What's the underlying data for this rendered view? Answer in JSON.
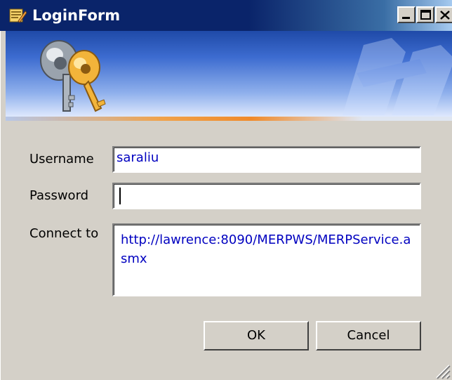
{
  "window": {
    "title": "LoginForm",
    "icon": "form-icon",
    "controls": {
      "minimize_icon": "minimize-icon",
      "maximize_icon": "maximize-icon",
      "close_icon": "close-icon"
    }
  },
  "banner": {
    "image": "keys-icon",
    "watermark": "keys-watermark"
  },
  "form": {
    "username_label": "Username",
    "username_value": "saraliu",
    "password_label": "Password",
    "password_value": "",
    "connect_label": "Connect to",
    "connect_value": "http://lawrence:8090/MERPWS/MERPService.asmx"
  },
  "buttons": {
    "ok": "OK",
    "cancel": "Cancel"
  },
  "colors": {
    "titlebar": "#0a246a",
    "window_face": "#d4d0c8",
    "field_text": "#0000c0",
    "banner_accent": "#f08a2a"
  }
}
